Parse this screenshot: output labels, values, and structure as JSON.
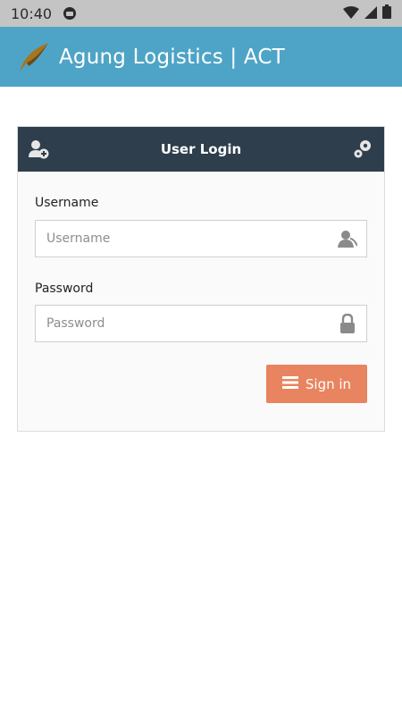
{
  "status_bar": {
    "time": "10:40",
    "icons": [
      "notification-icon",
      "wifi-icon",
      "signal-icon",
      "battery-icon"
    ]
  },
  "header": {
    "title": "Agung Logistics | ACT",
    "background": "#4ea4c6",
    "logo_icon": "logo-icon"
  },
  "login_card": {
    "title": "User Login",
    "header_background": "#2e3e4d",
    "left_icon": "user-add-icon",
    "right_icon": "settings-gear-icon",
    "username": {
      "label": "Username",
      "placeholder": "Username",
      "value": "",
      "icon": "user-icon"
    },
    "password": {
      "label": "Password",
      "placeholder": "Password",
      "value": "",
      "icon": "lock-icon"
    },
    "sign_in": {
      "label": "Sign in",
      "icon": "menu-lines-icon",
      "background": "#e8845f"
    }
  }
}
